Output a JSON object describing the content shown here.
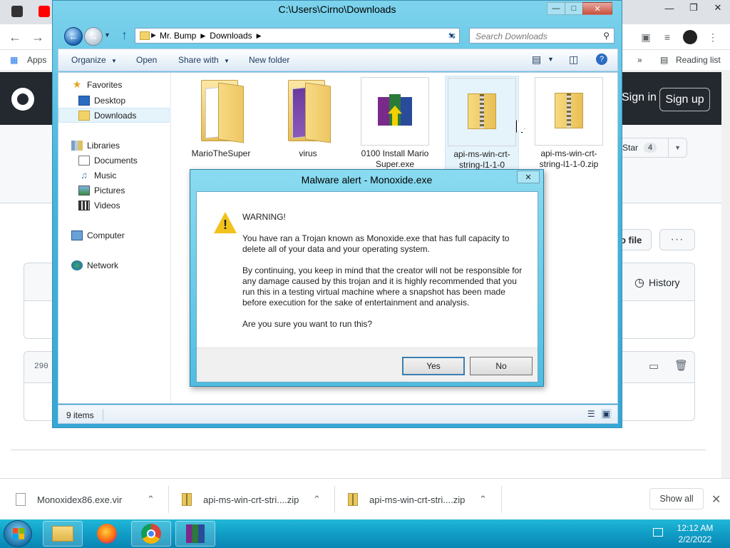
{
  "browser": {
    "bookmarks": {
      "apps": "Apps",
      "reading_list": "Reading list"
    },
    "github": {
      "sign_in": "Sign in",
      "sign_up": "Sign up",
      "star_label": "Star",
      "star_count": "4",
      "file_btn": "o file",
      "history": "History",
      "line_count": "290"
    }
  },
  "explorer": {
    "title": "C:\\Users\\Cirno\\Downloads",
    "breadcrumbs": [
      "Mr. Bump",
      "Downloads"
    ],
    "search_placeholder": "Search Downloads",
    "toolbar": {
      "organize": "Organize",
      "open": "Open",
      "share_with": "Share with",
      "new_folder": "New folder"
    },
    "nav": {
      "favorites": "Favorites",
      "desktop": "Desktop",
      "downloads": "Downloads",
      "libraries": "Libraries",
      "documents": "Documents",
      "music": "Music",
      "pictures": "Pictures",
      "videos": "Videos",
      "computer": "Computer",
      "network": "Network"
    },
    "files": [
      {
        "name": "MarioTheSuper",
        "icon": "folder-icon"
      },
      {
        "name": "virus",
        "icon": "folder-icon"
      },
      {
        "name": "0100 Install Mario Super.exe",
        "icon": "winrar-icon"
      },
      {
        "name": "api-ms-win-crt-string-l1-1-0",
        "icon": "zip-folder-icon"
      },
      {
        "name": "api-ms-win-crt-string-l1-1-0.zip",
        "icon": "zip-folder-icon"
      }
    ],
    "status_count": "9 items"
  },
  "dialog": {
    "title": "Malware alert - Monoxide.exe",
    "heading": "WARNING!",
    "paragraph1": "You have ran a Trojan known as Monoxide.exe that has full capacity to delete all of your data and your operating system.",
    "paragraph2": "By continuing, you keep in mind that the creator will not be responsible for any damage caused by this trojan and it is highly recommended that you run this in a testing virtual machine where a snapshot has been made before execution for the sake of entertainment and analysis.",
    "question": "Are you sure you want to run this?",
    "yes": "Yes",
    "no": "No"
  },
  "downloads_shelf": {
    "items": [
      "Monoxidex86.exe.vir",
      "api-ms-win-crt-stri....zip",
      "api-ms-win-crt-stri....zip"
    ],
    "show_all": "Show all"
  },
  "taskbar": {
    "time": "12:12 AM",
    "date": "2/2/2022"
  }
}
